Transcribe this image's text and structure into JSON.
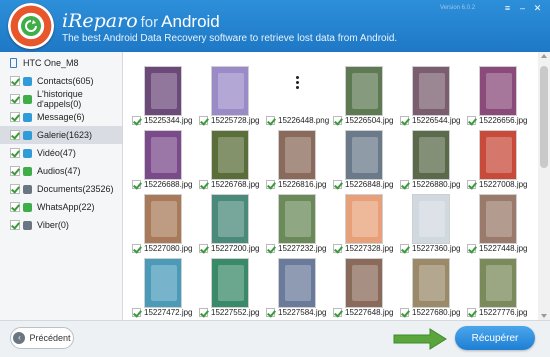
{
  "header": {
    "title_main": "iReparo",
    "title_for": "for",
    "title_android": "Android",
    "subtitle": "The best Android Data Recovery software to retrieve lost data from Android.",
    "version": "Version 6.0.2"
  },
  "window_controls": [
    "menu-icon",
    "minimize-icon",
    "close-icon"
  ],
  "sidebar": {
    "device": "HTC One_M8",
    "categories": [
      {
        "label": "Contacts(605)",
        "icon": "contacts-icon",
        "color": "#2f9bd8"
      },
      {
        "label": "L'historique d'appels(0)",
        "icon": "phone-icon",
        "color": "#3fae49"
      },
      {
        "label": "Message(6)",
        "icon": "message-icon",
        "color": "#2f9bd8"
      },
      {
        "label": "Galerie(1623)",
        "icon": "gallery-icon",
        "color": "#2f9bd8"
      },
      {
        "label": "Vidéo(47)",
        "icon": "video-icon",
        "color": "#2f9bd8"
      },
      {
        "label": "Audios(47)",
        "icon": "audio-icon",
        "color": "#3fae49"
      },
      {
        "label": "Documents(23526)",
        "icon": "document-icon",
        "color": "#6a7682"
      },
      {
        "label": "WhatsApp(22)",
        "icon": "whatsapp-icon",
        "color": "#3fae49"
      },
      {
        "label": "Viber(0)",
        "icon": "viber-icon",
        "color": "#6a7682"
      }
    ]
  },
  "gallery": {
    "items": [
      {
        "name": "15225344.jpg",
        "color": "#6b4a7a"
      },
      {
        "name": "15225728.jpg",
        "color": "#9a8bc7"
      },
      {
        "name": "15226448.png",
        "color": "#ffffff"
      },
      {
        "name": "15226504.jpg",
        "color": "#5e7a52"
      },
      {
        "name": "15226544.jpg",
        "color": "#7a5e6f"
      },
      {
        "name": "15226656.jpg",
        "color": "#8a4a7a"
      },
      {
        "name": "15226688.jpg",
        "color": "#7a4a8a"
      },
      {
        "name": "15226768.jpg",
        "color": "#5a6e3a"
      },
      {
        "name": "15226816.jpg",
        "color": "#8a6a5a"
      },
      {
        "name": "15226848.jpg",
        "color": "#6a7a8a"
      },
      {
        "name": "15226880.jpg",
        "color": "#5a6a4a"
      },
      {
        "name": "15227008.jpg",
        "color": "#c84a3a"
      },
      {
        "name": "15227080.jpg",
        "color": "#a87a5a"
      },
      {
        "name": "15227200.jpg",
        "color": "#4a8a7a"
      },
      {
        "name": "15227232.jpg",
        "color": "#6a8a5a"
      },
      {
        "name": "15227328.jpg",
        "color": "#e8a07a"
      },
      {
        "name": "15227360.jpg",
        "color": "#d0d8e0"
      },
      {
        "name": "15227448.jpg",
        "color": "#9a7a6a"
      },
      {
        "name": "15227472.jpg",
        "color": "#4a9ab8"
      },
      {
        "name": "15227552.jpg",
        "color": "#3a8a6a"
      },
      {
        "name": "15227584.jpg",
        "color": "#6a7a9a"
      },
      {
        "name": "15227648.jpg",
        "color": "#8a6a5a"
      },
      {
        "name": "15227680.jpg",
        "color": "#9a8a6a"
      },
      {
        "name": "15227776.jpg",
        "color": "#7a8a5a"
      }
    ]
  },
  "footer": {
    "prev_label": "Précédent",
    "recover_label": "Récupérer"
  }
}
